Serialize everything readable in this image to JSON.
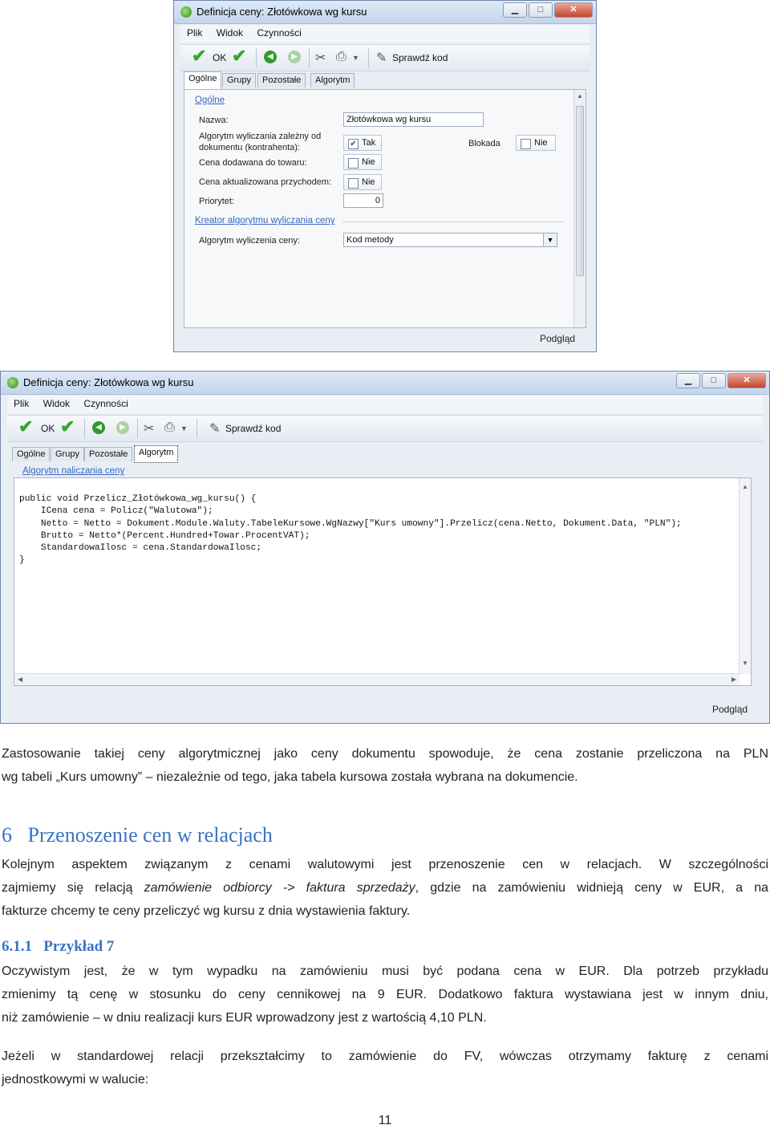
{
  "window1": {
    "title": "Definicja ceny: Złotówkowa wg kursu",
    "menu": [
      "Plik",
      "Widok",
      "Czynności"
    ],
    "toolbar": {
      "ok_label": "OK",
      "check_code_label": "Sprawdź kod"
    },
    "tabs": [
      "Ogólne",
      "Grupy",
      "Pozostałe",
      "Algorytm"
    ],
    "section_general": "Ogólne",
    "fields": {
      "name_label": "Nazwa:",
      "name_value": "Złotówkowa wg kursu",
      "algo_dependent_label_1": "Algorytm wyliczania zależny od",
      "algo_dependent_label_2": "dokumentu (kontrahenta):",
      "algo_dependent_value": "Tak",
      "block_label": "Blokada",
      "block_value": "Nie",
      "added_to_product_label": "Cena dodawana do towaru:",
      "added_to_product_value": "Nie",
      "updated_by_receipt_label": "Cena aktualizowana przychodem:",
      "updated_by_receipt_value": "Nie",
      "priority_label": "Priorytet:",
      "priority_value": "0"
    },
    "section_creator": "Kreator algorytmu wyliczania ceny",
    "algo_label": "Algorytm wyliczenia ceny:",
    "algo_value": "Kod metody",
    "status": "Podgląd"
  },
  "window2": {
    "title": "Definicja ceny: Złotówkowa wg kursu",
    "menu": [
      "Plik",
      "Widok",
      "Czynności"
    ],
    "toolbar": {
      "ok_label": "OK",
      "check_code_label": "Sprawdź kod"
    },
    "tabs": [
      "Ogólne",
      "Grupy",
      "Pozostałe",
      "Algorytm"
    ],
    "section_algo": "Algorytm naliczania ceny",
    "code": [
      "public void Przelicz_Złotówkowa_wg_kursu() {",
      "    ICena cena = Policz(\"Walutowa\");",
      "    Netto = Netto = Dokument.Module.Waluty.TabeleKursowe.WgNazwy[\"Kurs umowny\"].Przelicz(cena.Netto, Dokument.Data, \"PLN\");",
      "    Brutto = Netto*(Percent.Hundred+Towar.ProcentVAT);",
      "    StandardowaIlosc = cena.StandardowaIlosc;",
      "}"
    ],
    "status": "Podgląd"
  },
  "text": {
    "p1": [
      "Zastosowanie takiej ceny algorytmicznej jako ceny dokumentu spowoduje, że cena zostanie przeliczona na PLN",
      "wg tabeli „Kurs umowny” – niezależnie od tego, jaka tabela kursowa została wybrana na dokumencie."
    ],
    "h6_number": "6",
    "h6_title": "Przenoszenie cen w relacjach",
    "p2_line1": "Kolejnym aspektem związanym z cenami walutowymi jest przenoszenie cen w relacjach. W szczególności",
    "p2_line2_a": "zajmiemy się relacją ",
    "p2_line2_em": "zamówienie odbiorcy -> faktura sprzedaży",
    "p2_line2_b": ", gdzie na zamówieniu widnieją ceny w EUR, a na",
    "p2_line3": "fakturze chcemy te ceny przeliczyć wg kursu z dnia wystawienia faktury.",
    "h611_number": "6.1.1",
    "h611_title": "Przykład 7",
    "p3": [
      "Oczywistym jest, że w tym wypadku na zamówieniu musi być podana cena w EUR. Dla potrzeb przykładu",
      "zmienimy tą cenę w stosunku do ceny cennikowej na 9 EUR. Dodatkowo faktura wystawiana jest w innym dniu,",
      "niż zamówienie – w dniu realizacji kurs EUR wprowadzony jest z wartością 4,10 PLN."
    ],
    "p4": [
      "Jeżeli w standardowej relacji przekształcimy to zamówienie do FV, wówczas otrzymamy fakturę z cenami",
      "jednostkowymi w walucie:"
    ],
    "page_number": "11"
  }
}
